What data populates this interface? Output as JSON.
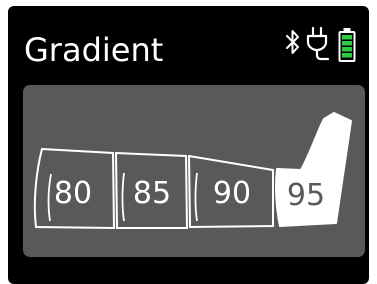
{
  "screen": {
    "title": "Gradient"
  },
  "status_icons": [
    "bluetooth-icon",
    "plug-icon",
    "battery-icon"
  ],
  "battery": {
    "level": 1.0,
    "color": "#2ecc40"
  },
  "limb": {
    "segments": [
      {
        "label": "80",
        "active": false
      },
      {
        "label": "85",
        "active": false
      },
      {
        "label": "90",
        "active": false
      },
      {
        "label": "95",
        "active": true
      }
    ]
  },
  "colors": {
    "background": "#000000",
    "panel": "#595959",
    "outline": "#ffffff",
    "active_fill": "#ffffff",
    "active_text": "#595959",
    "text": "#ffffff"
  }
}
